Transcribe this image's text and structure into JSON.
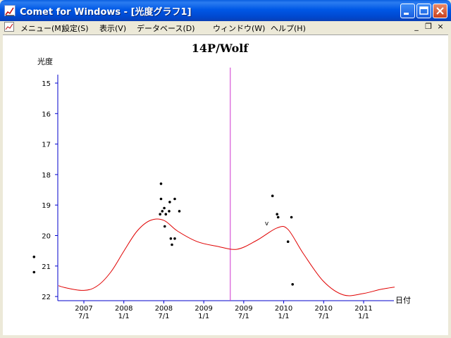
{
  "window": {
    "title": "Comet for Windows - [光度グラフ1]",
    "minimize_icon": "minimize-icon",
    "maximize_icon": "maximize-icon",
    "close_icon": "close-icon"
  },
  "menubar": {
    "items": [
      {
        "label": "メニュー(M)"
      },
      {
        "label": "設定(S)"
      },
      {
        "label": "表示(V)"
      },
      {
        "label": "データベース(D)"
      },
      {
        "label": "ウィンドウ(W)"
      },
      {
        "label": "ヘルプ(H)"
      }
    ],
    "mdi_minimize": "_",
    "mdi_restore": "❐",
    "mdi_close": "×"
  },
  "chart_data": {
    "type": "scatter",
    "title": "14P/Wolf",
    "ylabel": "光度",
    "xlabel": "日付",
    "ylim": [
      22,
      14.5
    ],
    "y_ticks": [
      "15",
      "16",
      "17",
      "18",
      "19",
      "20",
      "21",
      "22"
    ],
    "x_tick_labels": [
      {
        "year": "2007",
        "date": "7/1"
      },
      {
        "year": "2008",
        "date": "1/1"
      },
      {
        "year": "2008",
        "date": "7/1"
      },
      {
        "year": "2009",
        "date": "1/1"
      },
      {
        "year": "2009",
        "date": "7/1"
      },
      {
        "year": "2010",
        "date": "1/1"
      },
      {
        "year": "2010",
        "date": "7/1"
      },
      {
        "year": "2011",
        "date": "1/1"
      }
    ],
    "current_date_line": "2009-05-01",
    "observations": [
      {
        "date": "2006-11-15",
        "mag": 20.7
      },
      {
        "date": "2006-11-15",
        "mag": 21.2
      },
      {
        "date": "2008-06-18",
        "mag": 18.3
      },
      {
        "date": "2008-06-18",
        "mag": 18.8
      },
      {
        "date": "2008-06-14",
        "mag": 19.3
      },
      {
        "date": "2008-06-24",
        "mag": 19.2
      },
      {
        "date": "2008-07-03",
        "mag": 19.1
      },
      {
        "date": "2008-07-05",
        "mag": 19.7
      },
      {
        "date": "2008-07-10",
        "mag": 19.3
      },
      {
        "date": "2008-07-25",
        "mag": 19.2
      },
      {
        "date": "2008-07-28",
        "mag": 18.9
      },
      {
        "date": "2008-08-02",
        "mag": 20.1
      },
      {
        "date": "2008-08-07",
        "mag": 20.3
      },
      {
        "date": "2008-08-20",
        "mag": 18.8
      },
      {
        "date": "2008-08-20",
        "mag": 20.1
      },
      {
        "date": "2008-09-10",
        "mag": 19.2
      },
      {
        "date": "2009-11-10",
        "mag": 18.7
      },
      {
        "date": "2009-12-01",
        "mag": 19.3
      },
      {
        "date": "2009-12-06",
        "mag": 19.4
      },
      {
        "date": "2010-01-20",
        "mag": 20.2
      },
      {
        "date": "2010-02-05",
        "mag": 19.4
      },
      {
        "date": "2010-02-10",
        "mag": 21.6
      }
    ],
    "upper_limit_marker": {
      "date": "2009-10-15",
      "mag": 19.6,
      "symbol": "v"
    },
    "predicted_curve": [
      {
        "date": "2006-05-25",
        "mag": 22.0
      },
      {
        "date": "2006-08-01",
        "mag": 21.7
      },
      {
        "date": "2006-10-01",
        "mag": 21.5
      },
      {
        "date": "2007-01-01",
        "mag": 21.5
      },
      {
        "date": "2007-04-01",
        "mag": 21.7
      },
      {
        "date": "2007-07-01",
        "mag": 21.8
      },
      {
        "date": "2007-09-01",
        "mag": 21.65
      },
      {
        "date": "2007-11-01",
        "mag": 21.2
      },
      {
        "date": "2008-01-01",
        "mag": 20.5
      },
      {
        "date": "2008-03-01",
        "mag": 19.85
      },
      {
        "date": "2008-05-01",
        "mag": 19.5
      },
      {
        "date": "2008-07-01",
        "mag": 19.5
      },
      {
        "date": "2008-09-01",
        "mag": 19.85
      },
      {
        "date": "2008-12-01",
        "mag": 20.2
      },
      {
        "date": "2009-03-01",
        "mag": 20.35
      },
      {
        "date": "2009-06-01",
        "mag": 20.45
      },
      {
        "date": "2009-09-01",
        "mag": 20.15
      },
      {
        "date": "2009-12-01",
        "mag": 19.75
      },
      {
        "date": "2010-01-20",
        "mag": 19.8
      },
      {
        "date": "2010-04-01",
        "mag": 20.6
      },
      {
        "date": "2010-07-01",
        "mag": 21.5
      },
      {
        "date": "2010-10-01",
        "mag": 21.95
      },
      {
        "date": "2011-01-01",
        "mag": 21.9
      },
      {
        "date": "2011-04-01",
        "mag": 21.75
      },
      {
        "date": "2011-07-01",
        "mag": 21.7
      },
      {
        "date": "2011-10-01",
        "mag": 22.0
      }
    ],
    "colors": {
      "curve": "#e00000",
      "date_line": "#cc33cc",
      "axis": "#0000cc",
      "points": "#000000"
    }
  }
}
